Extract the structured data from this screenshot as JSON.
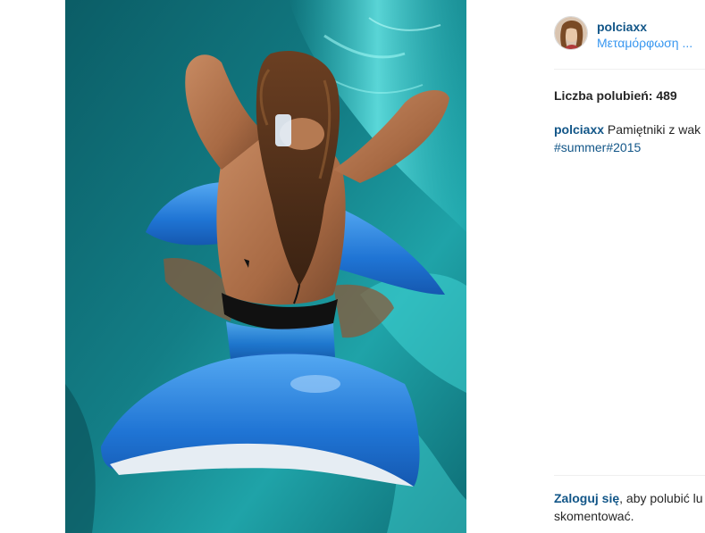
{
  "post": {
    "image_alt": "Photo of a person floating on an inflatable dolphin in a pool",
    "author": {
      "username": "polciaxx",
      "location": "Μεταμόρφωση ..."
    },
    "likes_text": "Liczba polubień: 489",
    "caption": {
      "username": "polciaxx",
      "text": "Pamiętniki z wak",
      "hashtag_1": "#summer",
      "hashtag_2": "#2015"
    },
    "login_prompt": {
      "link": "Zaloguj się",
      "text_1": ", aby polubić lu",
      "text_2": "skomentować."
    }
  },
  "colors": {
    "link": "#125688",
    "location": "#3897f0",
    "text": "#262626",
    "divider": "#efefef",
    "pool": "#0f6f78"
  }
}
